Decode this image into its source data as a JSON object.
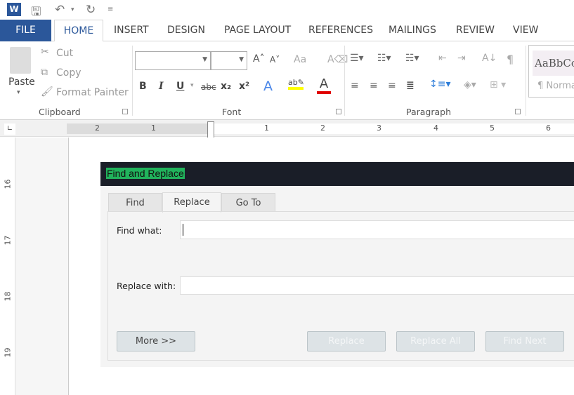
{
  "quick_access": {
    "icons": [
      "word-logo-icon",
      "save-icon",
      "undo-icon",
      "redo-icon",
      "customize-icon"
    ]
  },
  "ribbon_tabs": [
    "FILE",
    "HOME",
    "INSERT",
    "DESIGN",
    "PAGE LAYOUT",
    "REFERENCES",
    "MAILINGS",
    "REVIEW",
    "VIEW"
  ],
  "active_tab": "HOME",
  "clipboard": {
    "paste": "Paste",
    "cut": "Cut",
    "copy": "Copy",
    "format_painter": "Format Painter",
    "label": "Clipboard"
  },
  "font": {
    "label": "Font",
    "font_name": "",
    "font_size": "",
    "change_case": "Aa",
    "bold": "B",
    "italic": "I",
    "underline": "U",
    "strike": "abc",
    "subscript": "x₂",
    "superscript": "x²",
    "highlight_color": "#ffff00",
    "font_color": "#e00000"
  },
  "paragraph": {
    "label": "Paragraph",
    "pilcrow": "¶"
  },
  "styles": {
    "preview": "AaBbCc",
    "name": "¶ Normal"
  },
  "ruler": {
    "numbers": [
      "2",
      "1",
      "1",
      "2",
      "3",
      "4",
      "5",
      "6"
    ]
  },
  "vertical_ruler": {
    "numbers": [
      "16",
      "17",
      "18",
      "19"
    ]
  },
  "dialog": {
    "title": "Find and Replace",
    "title_highlight": "#21b35c",
    "tabs": [
      "Find",
      "Replace",
      "Go To"
    ],
    "active_tab": "Replace",
    "find_label": "Find what:",
    "find_value": "",
    "replace_label": "Replace with:",
    "replace_value": "",
    "buttons": {
      "more": "More >>",
      "replace": "Replace",
      "replace_all": "Replace All",
      "find_next": "Find Next"
    }
  }
}
